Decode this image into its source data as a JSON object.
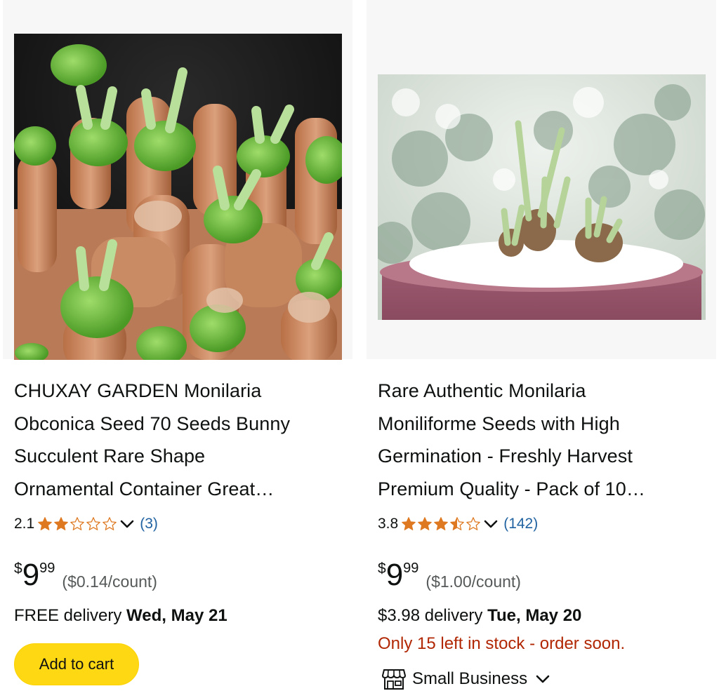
{
  "products": [
    {
      "title_lines": [
        "CHUXAY GARDEN Monilaria",
        "Obconica Seed 70 Seeds Bunny",
        "Succulent Rare Shape",
        "Ornamental Container Great…"
      ],
      "rating_value": "2.1",
      "stars": {
        "filled": 2,
        "half": 0,
        "total": 5,
        "rating": 2.1
      },
      "review_count": "(3)",
      "price": {
        "currency": "$",
        "whole": "9",
        "fraction": "99",
        "unit_price": "($0.14/count)"
      },
      "delivery": {
        "prefix": "FREE delivery",
        "date": "Wed, May 21"
      },
      "add_to_cart_label": "Add to cart"
    },
    {
      "title_lines": [
        "Rare Authentic Monilaria",
        "Moniliforme Seeds with High",
        "Germination - Freshly Harvest",
        "Premium Quality - Pack of 10…"
      ],
      "rating_value": "3.8",
      "stars": {
        "filled": 3,
        "half": 1,
        "total": 5,
        "rating": 3.8
      },
      "review_count": "(142)",
      "price": {
        "currency": "$",
        "whole": "9",
        "fraction": "99",
        "unit_price": "($1.00/count)"
      },
      "delivery": {
        "prefix": "$3.98 delivery",
        "date": "Tue, May 20"
      },
      "stock_message": "Only 15 left in stock - order soon.",
      "badge_label": "Small Business"
    }
  ],
  "colors": {
    "star": "#de7921",
    "link": "#2162a1",
    "stock": "#b12704",
    "button": "#ffd814",
    "text": "#0f1111",
    "secondary": "#565959"
  },
  "icons": [
    "star-icon",
    "chevron-down-icon",
    "storefront-icon"
  ]
}
